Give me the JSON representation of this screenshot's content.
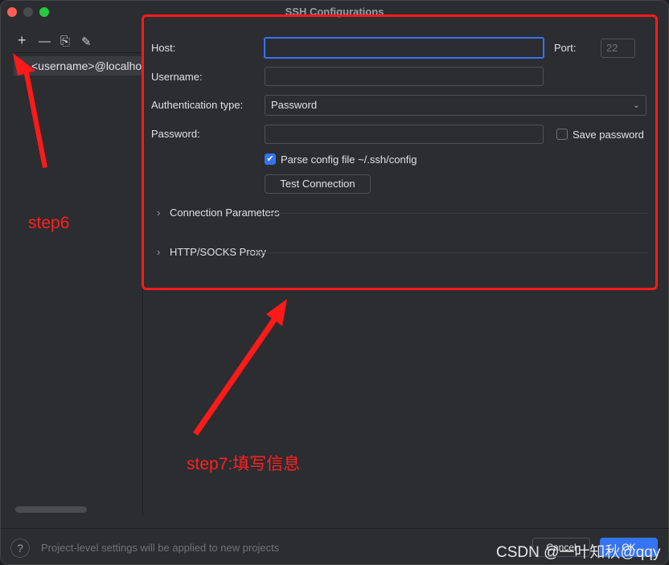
{
  "window": {
    "title": "SSH Configurations"
  },
  "sidebar": {
    "tools": [
      {
        "icon": "plus-icon",
        "glyph": "+"
      },
      {
        "icon": "minus-icon",
        "glyph": "—"
      },
      {
        "icon": "copy-icon",
        "glyph": "⎘"
      },
      {
        "icon": "edit-icon",
        "glyph": "✎"
      }
    ],
    "items": [
      {
        "label": "<username>@localhost"
      }
    ]
  },
  "form": {
    "host": {
      "label": "Host:",
      "value": ""
    },
    "port": {
      "label": "Port:",
      "placeholder": "22"
    },
    "username": {
      "label": "Username:",
      "value": ""
    },
    "auth": {
      "label": "Authentication type:",
      "value": "Password"
    },
    "password": {
      "label": "Password:",
      "value": ""
    },
    "save_password": {
      "label": "Save password",
      "checked": false
    },
    "parse_config": {
      "label": "Parse config file ~/.ssh/config",
      "checked": true
    },
    "test_button": "Test Connection",
    "sections": [
      {
        "label": "Connection Parameters"
      },
      {
        "label": "HTTP/SOCKS Proxy"
      }
    ]
  },
  "footer": {
    "help": "?",
    "note": "Project-level settings will be applied to new projects",
    "cancel": "Cancel",
    "ok": "OK"
  },
  "annotations": {
    "step6": "step6",
    "step7": "step7:填写信息",
    "color": "#ff2020"
  },
  "watermark": "CSDN @一叶知秋@qqy"
}
